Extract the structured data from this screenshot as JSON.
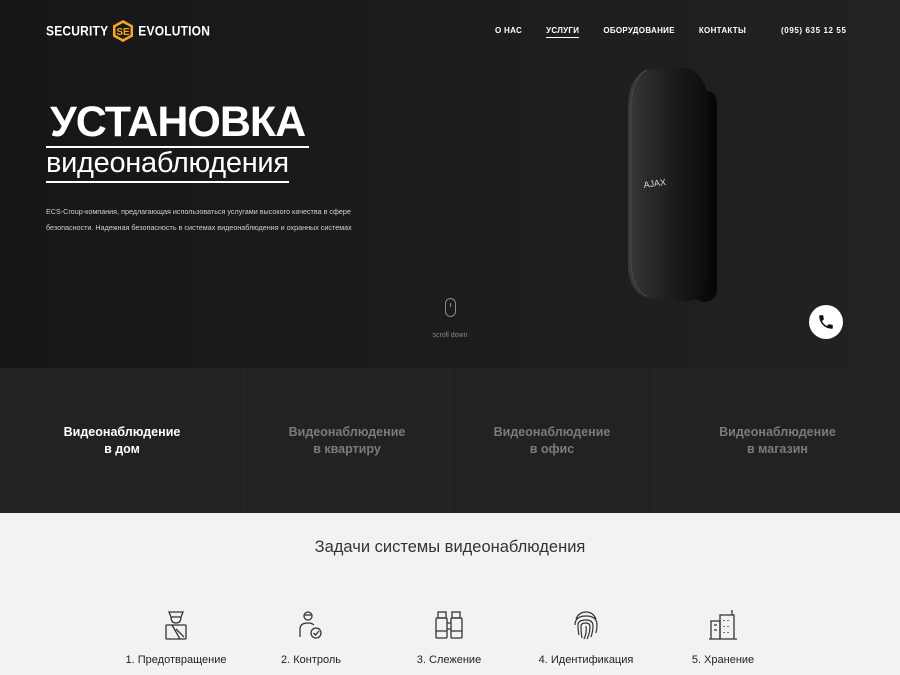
{
  "header": {
    "logo_left": "SECURITY",
    "logo_right": "EVOLUTION",
    "nav": [
      {
        "label": "О НАС"
      },
      {
        "label": "УСЛУГИ"
      },
      {
        "label": "ОБОРУДОВАНИЕ"
      },
      {
        "label": "КОНТАКТЫ"
      }
    ],
    "active_nav": "УСЛУГИ",
    "phone": "(095) 635 12 55"
  },
  "hero": {
    "title_main": "УСТАНОВКА",
    "title_sub": "видеонаблюдения",
    "description": "ECS-Croup-компания, предлагающая использоваться услугами высокого качества в сфере безопасности. Надежная безопасность в системах видеонаблюдения и охранных системах",
    "device_brand": "AJAX",
    "scroll_label": "scroll down"
  },
  "tabs": [
    {
      "label": "Видеонаблюдение\nв дом",
      "active": true
    },
    {
      "label": "Видеонаблюдение\nв квартиру",
      "active": false
    },
    {
      "label": "Видеонаблюдение\nв офис",
      "active": false
    },
    {
      "label": "Видеонаблюдение\nв магазин",
      "active": false
    }
  ],
  "tasks": {
    "title": "Задачи системы видеонаблюдения",
    "items": [
      {
        "label": "1. Предотвращение",
        "icon": "guard-icon"
      },
      {
        "label": "2. Контроль",
        "icon": "user-check-icon"
      },
      {
        "label": "3. Слежение",
        "icon": "binoculars-icon"
      },
      {
        "label": "4. Идентификация",
        "icon": "fingerprint-icon"
      },
      {
        "label": "5.  Хранение",
        "icon": "building-icon"
      }
    ]
  },
  "colors": {
    "hero_bg": "#1b1b1d",
    "tabs_bg": "#222222",
    "accent": "#f5a623",
    "light_bg": "#f2f2f2"
  }
}
